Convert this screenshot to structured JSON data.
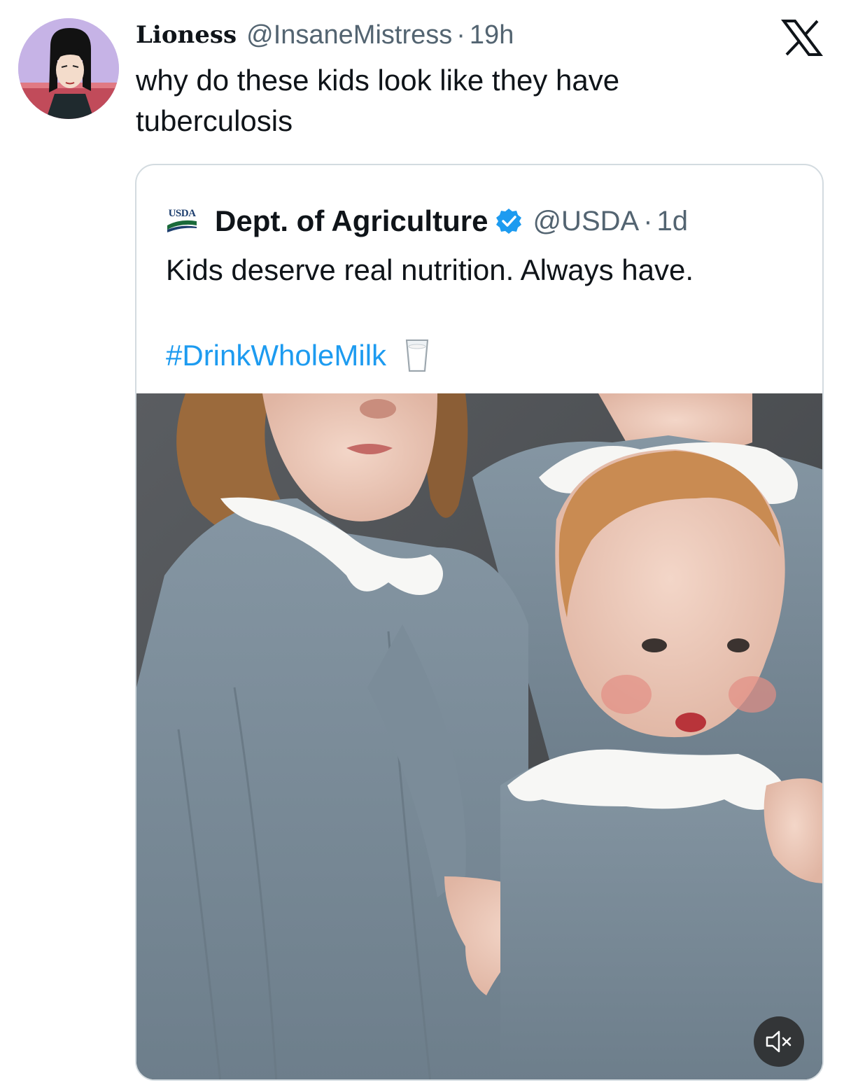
{
  "tweet": {
    "display_name": "Lioness",
    "handle": "@InsaneMistress",
    "separator": "·",
    "time": "19h",
    "text": "why do these kids look like they have tuberculosis"
  },
  "app_logo_icon": "x-logo-icon",
  "quoted_tweet": {
    "logo_text": "USDA",
    "display_name": "Dept. of Agriculture",
    "verified_icon": "verified-badge-icon",
    "handle": "@USDA",
    "separator": "·",
    "time": "1d",
    "text": "Kids deserve real nutrition. Always have.",
    "hashtag": "#DrinkWholeMilk",
    "emoji_icon": "glass-of-milk-icon",
    "media_control_icon": "speaker-muted-icon"
  },
  "colors": {
    "link_blue": "#1d9bf0",
    "verified_blue": "#1d9bf0",
    "secondary_text": "#536471",
    "border": "#d3dbe0"
  }
}
